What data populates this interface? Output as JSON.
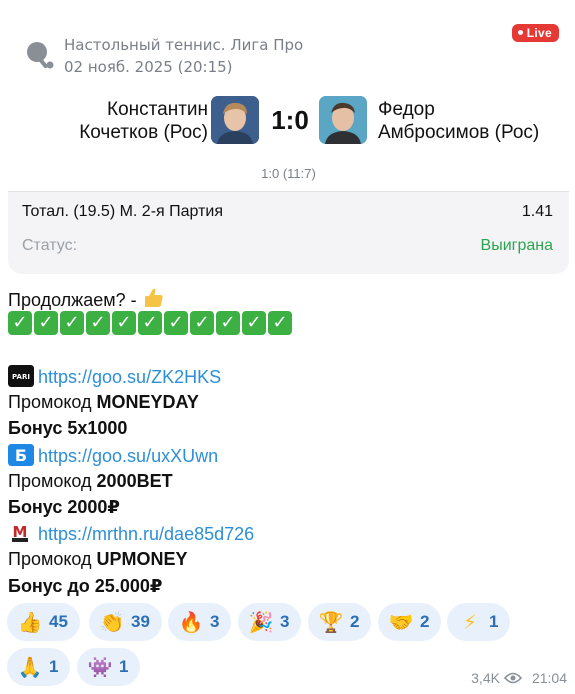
{
  "card": {
    "league": "Настольный теннис. Лига Про",
    "date": "02 нояб. 2025 (20:15)",
    "live_badge": "Live",
    "player1": {
      "line1": "Константин",
      "line2": "Кочетков (Рос)"
    },
    "player2": {
      "line1": "Федор",
      "line2": "Амбросимов (Рос)"
    },
    "score": "1:0",
    "set_score": "1:0 (11:7)",
    "bet": {
      "name": "Тотал. (19.5) М. 2-я Партия",
      "odds": "1.41"
    },
    "status": {
      "label": "Статус:",
      "value": "Выиграна"
    }
  },
  "message": {
    "line1": "Продолжаем? -",
    "checks_count": 11,
    "block1": {
      "link": "https://goo.su/ZK2HKS",
      "promo_prefix": "Промокод ",
      "promo_code": "MONEYDAY",
      "bonus": "Бонус 5х1000"
    },
    "block2": {
      "link": "https://goo.su/uxXUwn",
      "promo_prefix": "Промокод ",
      "promo_code": "2000BET",
      "bonus": "Бонус 2000₽"
    },
    "block3": {
      "link": "https://mrthn.ru/dae85d726",
      "promo_prefix": "Промокод ",
      "promo_code": "UPMONEY",
      "bonus": "Бонус до 25.000₽"
    }
  },
  "reactions": [
    {
      "icon": "thumbs-up-icon",
      "count": "45"
    },
    {
      "icon": "clapping-hands-icon",
      "count": "39"
    },
    {
      "icon": "fire-icon",
      "count": "3"
    },
    {
      "icon": "party-popper-icon",
      "count": "3"
    },
    {
      "icon": "trophy-icon",
      "count": "2"
    },
    {
      "icon": "handshake-icon",
      "count": "2"
    },
    {
      "icon": "lightning-icon",
      "count": "1"
    },
    {
      "icon": "praying-hands-icon",
      "count": "1"
    },
    {
      "icon": "space-invader-icon",
      "count": "1"
    }
  ],
  "meta": {
    "views": "3,4K",
    "time": "21:04"
  },
  "colors": {
    "live": "#e53935",
    "won": "#2ea44f",
    "link": "#2c8fd8",
    "reaction_bg": "#e8f1fb",
    "check": "#3cb043"
  }
}
